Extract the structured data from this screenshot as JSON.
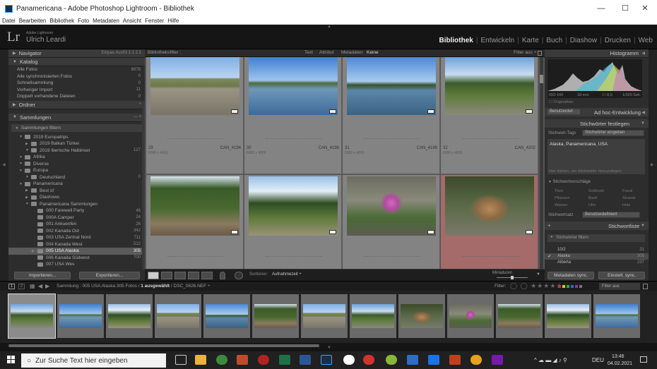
{
  "window": {
    "title": "Panamericana - Adobe Photoshop Lightroom - Bibliothek",
    "minimize": "—",
    "maximize": "☐",
    "close": "✕"
  },
  "menu": [
    "Datei",
    "Bearbeiten",
    "Bibliothek",
    "Foto",
    "Metadaten",
    "Ansicht",
    "Fenster",
    "Hilfe"
  ],
  "identity": {
    "logo": "Lr",
    "small": "Adobe Lightroom",
    "name": "Ulrich Leardi"
  },
  "modules": [
    {
      "label": "Bibliothek",
      "active": true
    },
    {
      "label": "Entwickeln"
    },
    {
      "label": "Karte"
    },
    {
      "label": "Buch"
    },
    {
      "label": "Diashow"
    },
    {
      "label": "Drucken"
    },
    {
      "label": "Web"
    }
  ],
  "left": {
    "navigator": {
      "title": "Navigator",
      "opts": "Einpas  Ausfül  1:1  2:1"
    },
    "catalog": {
      "title": "Katalog",
      "items": [
        {
          "label": "Alle Fotos",
          "count": "8976"
        },
        {
          "label": "Alle synchronisierten Fotos",
          "count": "0"
        },
        {
          "label": "Schnellsammlung",
          "count": "0"
        },
        {
          "label": "Vorheriger Import",
          "count": "11"
        },
        {
          "label": "Doppelt vorhandene Dateien",
          "count": "0"
        }
      ]
    },
    "folders": {
      "title": "Ordner",
      "right": "+"
    },
    "collections": {
      "title": "Sammlungen",
      "right": "— +",
      "filter": "Sammlungen filtern",
      "items": [
        {
          "label": "2019 Europatrips",
          "count": "",
          "indent": 1
        },
        {
          "label": "2019 Balkan Türkei",
          "count": "",
          "indent": 2
        },
        {
          "label": "2019 Iberische Halbinsel",
          "count": "127",
          "indent": 2
        },
        {
          "label": "Afrika",
          "count": "",
          "indent": 1
        },
        {
          "label": "Diverse",
          "count": "",
          "indent": 1
        },
        {
          "label": "Europa",
          "count": "",
          "indent": 1
        },
        {
          "label": "Deutschland",
          "count": "0",
          "indent": 2
        },
        {
          "label": "Panamericana",
          "count": "",
          "indent": 1
        },
        {
          "label": "Best of",
          "count": "",
          "indent": 2
        },
        {
          "label": "Diashows",
          "count": "",
          "indent": 2
        },
        {
          "label": "Panamericana Sammlungen",
          "count": "",
          "indent": 2
        },
        {
          "label": "000 Farewell Party",
          "count": "46",
          "indent": 3
        },
        {
          "label": "000A Camper",
          "count": "24",
          "indent": 3
        },
        {
          "label": "001 Ankuenfen",
          "count": "26",
          "indent": 3
        },
        {
          "label": "002 Kanada Ost",
          "count": "342",
          "indent": 3
        },
        {
          "label": "003 USA Zentral Nord",
          "count": "711",
          "indent": 3
        },
        {
          "label": "004 Kanada West",
          "count": "512",
          "indent": 3
        },
        {
          "label": "005 USA Alaska",
          "count": "305",
          "indent": 3,
          "selected": true
        },
        {
          "label": "006 Kanada Südwest",
          "count": "700",
          "indent": 3
        },
        {
          "label": "007 USA Wes",
          "count": "",
          "indent": 3
        }
      ]
    },
    "import_btn": "Importieren...",
    "export_btn": "Exportieren..."
  },
  "filter": {
    "title": "Bibliotheksfilter :",
    "options": [
      "Text",
      "Attribut",
      "Metadaten",
      "Keine"
    ],
    "preset": "Filter aus ÷"
  },
  "grid": [
    {
      "num": "29",
      "size": "6000 x 4000",
      "file": "CAN_4194",
      "pal": "road"
    },
    {
      "num": "30",
      "size": "6000 x 4000",
      "file": "CAN_4196",
      "pal": "lake"
    },
    {
      "num": "31",
      "size": "6000 x 4000",
      "file": "CAN_4199",
      "pal": "lake2"
    },
    {
      "num": "32",
      "size": "6000 x 4000",
      "file": "CAN_4202",
      "pal": "camper"
    },
    {
      "num": "",
      "size": "",
      "file": "",
      "pal": "forest"
    },
    {
      "num": "",
      "size": "",
      "file": "",
      "pal": "clearing"
    },
    {
      "num": "",
      "size": "",
      "file": "",
      "pal": "flower"
    },
    {
      "num": "",
      "size": "",
      "file": "",
      "pal": "squirrel",
      "selected": true
    }
  ],
  "toolbar": {
    "sort_label": "Sortieren:",
    "sort_value": "Aufnahmezeit ÷",
    "thumbs": "Miniaturen"
  },
  "right": {
    "histogram": {
      "title": "Histogramm",
      "iso": "ISO 100",
      "mm": "18 mm",
      "f": "f / 8,0",
      "sec": "1/320 Sek.",
      "orig": "Originalfoto"
    },
    "quick": {
      "preset": "Benutzerdef.",
      "title": "Ad hoc-Entwicklung"
    },
    "keywording": {
      "title": "Stichwörter festlegen",
      "tags_label": "Stichwort-Tags",
      "tags_value": "Stichwörter eingeben",
      "keywords": "Alaska, Panamericana, USA",
      "hint": "Hier klicken, um Stichwörter hinzuzufügen",
      "suggestions_label": "Stichwortvorschläge",
      "suggestions": [
        "Tiere",
        "Goldrush",
        "Fossil",
        "Pflanzen",
        "Bach",
        "Strasse",
        "Wasser",
        "Ufer",
        "Hole"
      ],
      "set_label": "Stichwortsatz",
      "set_value": "Benutzerdefiniert"
    },
    "keywordlist": {
      "title": "Stichwortliste",
      "filter": "Stichwörter filtern",
      "items": [
        {
          "label": "10/2",
          "count": "31"
        },
        {
          "label": "Alaska",
          "count": "305",
          "checked": true
        },
        {
          "label": "Alberta",
          "count": "237"
        }
      ]
    },
    "sync_meta": "Metadaten sync.",
    "sync_settings": "Einstell. sync."
  },
  "filmbar": {
    "pages": [
      "1",
      "2"
    ],
    "path": "Sammlung : 005 USA Alaska   305 Fotos /",
    "selected": "1 ausgewählt",
    "file": "/ DSC_0626.NEF ÷",
    "filter_label": "Filter:",
    "filter_value": "Filter aus"
  },
  "taskbar": {
    "search": "Zur Suche Text hier eingeben",
    "lang": "DEU",
    "time": "13:46",
    "date": "04.02.2021"
  }
}
